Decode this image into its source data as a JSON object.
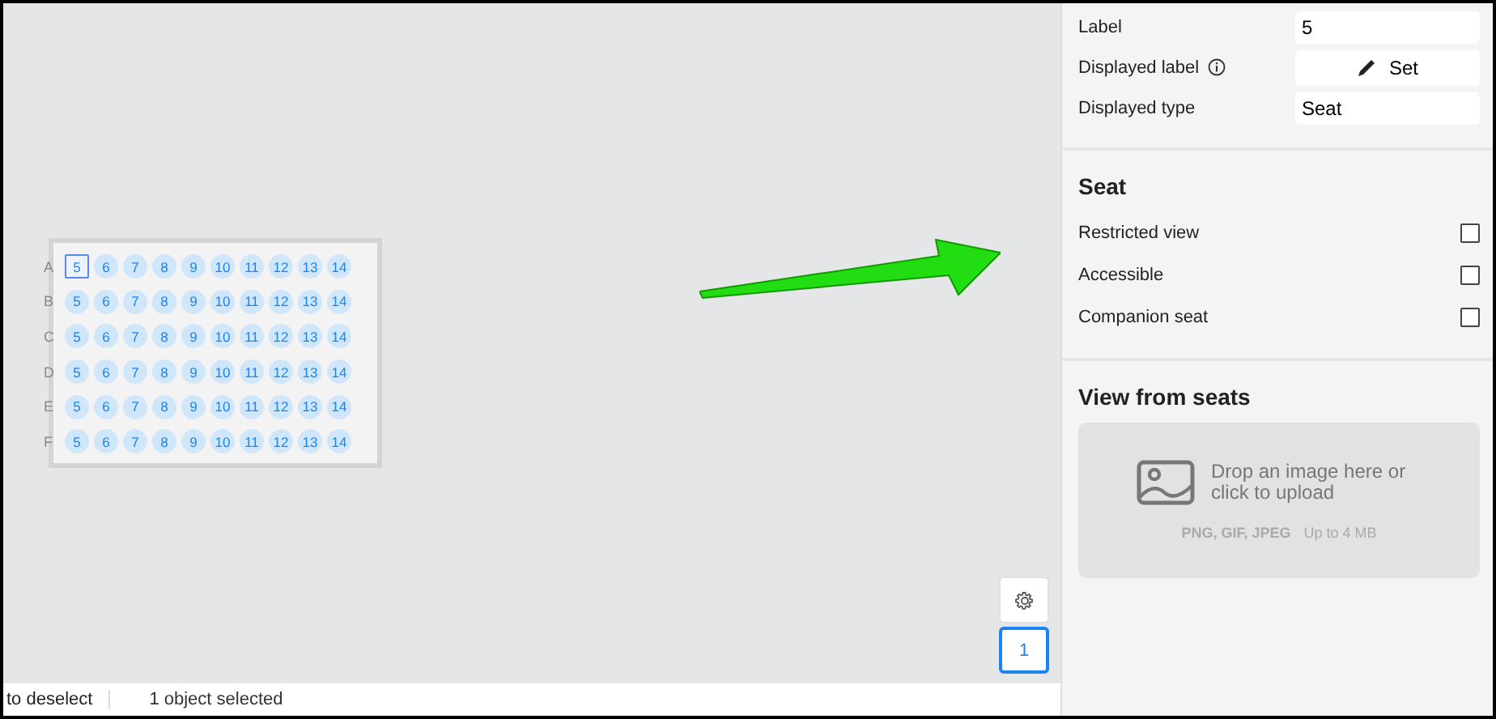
{
  "seat_map": {
    "rows": [
      {
        "label": "A",
        "seats": [
          {
            "label": "5",
            "selected": true
          },
          {
            "label": "6",
            "selected": false
          },
          {
            "label": "7",
            "selected": false
          },
          {
            "label": "8",
            "selected": false
          },
          {
            "label": "9",
            "selected": false
          },
          {
            "label": "10",
            "selected": false
          },
          {
            "label": "11",
            "selected": false
          },
          {
            "label": "12",
            "selected": false
          },
          {
            "label": "13",
            "selected": false
          },
          {
            "label": "14",
            "selected": false
          }
        ]
      },
      {
        "label": "B",
        "seats": [
          {
            "label": "5",
            "selected": false
          },
          {
            "label": "6",
            "selected": false
          },
          {
            "label": "7",
            "selected": false
          },
          {
            "label": "8",
            "selected": false
          },
          {
            "label": "9",
            "selected": false
          },
          {
            "label": "10",
            "selected": false
          },
          {
            "label": "11",
            "selected": false
          },
          {
            "label": "12",
            "selected": false
          },
          {
            "label": "13",
            "selected": false
          },
          {
            "label": "14",
            "selected": false
          }
        ]
      },
      {
        "label": "C",
        "seats": [
          {
            "label": "5",
            "selected": false
          },
          {
            "label": "6",
            "selected": false
          },
          {
            "label": "7",
            "selected": false
          },
          {
            "label": "8",
            "selected": false
          },
          {
            "label": "9",
            "selected": false
          },
          {
            "label": "10",
            "selected": false
          },
          {
            "label": "11",
            "selected": false
          },
          {
            "label": "12",
            "selected": false
          },
          {
            "label": "13",
            "selected": false
          },
          {
            "label": "14",
            "selected": false
          }
        ]
      },
      {
        "label": "D",
        "seats": [
          {
            "label": "5",
            "selected": false
          },
          {
            "label": "6",
            "selected": false
          },
          {
            "label": "7",
            "selected": false
          },
          {
            "label": "8",
            "selected": false
          },
          {
            "label": "9",
            "selected": false
          },
          {
            "label": "10",
            "selected": false
          },
          {
            "label": "11",
            "selected": false
          },
          {
            "label": "12",
            "selected": false
          },
          {
            "label": "13",
            "selected": false
          },
          {
            "label": "14",
            "selected": false
          }
        ]
      },
      {
        "label": "E",
        "seats": [
          {
            "label": "5",
            "selected": false
          },
          {
            "label": "6",
            "selected": false
          },
          {
            "label": "7",
            "selected": false
          },
          {
            "label": "8",
            "selected": false
          },
          {
            "label": "9",
            "selected": false
          },
          {
            "label": "10",
            "selected": false
          },
          {
            "label": "11",
            "selected": false
          },
          {
            "label": "12",
            "selected": false
          },
          {
            "label": "13",
            "selected": false
          },
          {
            "label": "14",
            "selected": false
          }
        ]
      },
      {
        "label": "F",
        "seats": [
          {
            "label": "5",
            "selected": false
          },
          {
            "label": "6",
            "selected": false
          },
          {
            "label": "7",
            "selected": false
          },
          {
            "label": "8",
            "selected": false
          },
          {
            "label": "9",
            "selected": false
          },
          {
            "label": "10",
            "selected": false
          },
          {
            "label": "11",
            "selected": false
          },
          {
            "label": "12",
            "selected": false
          },
          {
            "label": "13",
            "selected": false
          },
          {
            "label": "14",
            "selected": false
          }
        ]
      }
    ]
  },
  "zoom_level": "1",
  "status_bar": {
    "hint": "to deselect",
    "selection": "1 object selected"
  },
  "properties": {
    "label": {
      "label": "Label",
      "value": "5"
    },
    "displayed_label": {
      "label": "Displayed label",
      "button": "Set"
    },
    "displayed_type": {
      "label": "Displayed type",
      "value": "Seat"
    }
  },
  "seat_section": {
    "title": "Seat",
    "options": [
      {
        "label": "Restricted view",
        "checked": false
      },
      {
        "label": "Accessible",
        "checked": false
      },
      {
        "label": "Companion seat",
        "checked": false
      }
    ]
  },
  "view_from_seats": {
    "title": "View from seats",
    "drop_text": "Drop an image here or click to upload",
    "formats": "PNG, GIF, JPEG",
    "limit": "Up to 4 MB"
  }
}
